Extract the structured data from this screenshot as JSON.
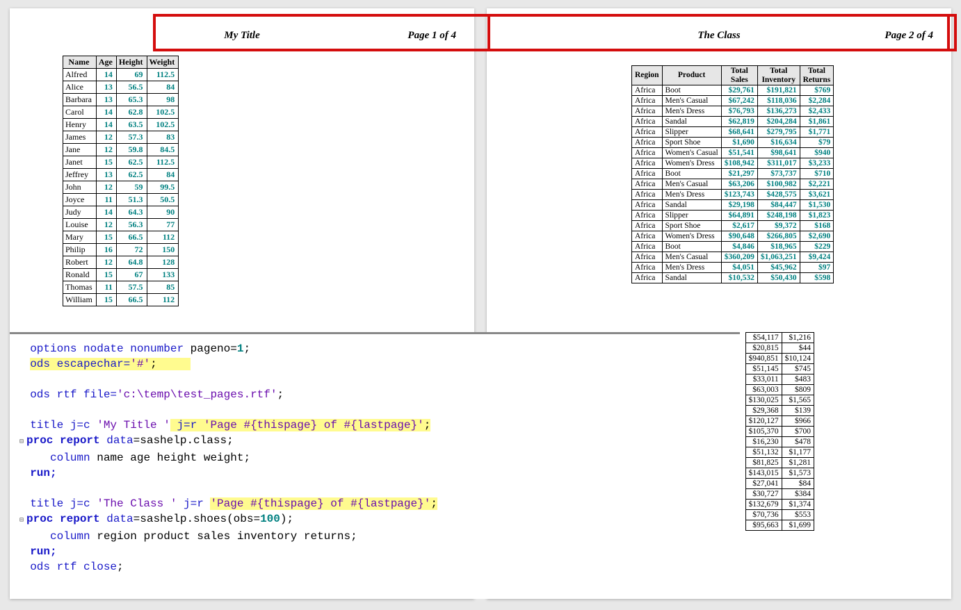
{
  "page1": {
    "title": "My Title",
    "page_label": "Page 1 of 4"
  },
  "page2": {
    "title": "The Class",
    "page_label": "Page 2 of 4"
  },
  "class_table": {
    "headers": [
      "Name",
      "Age",
      "Height",
      "Weight"
    ],
    "rows": [
      [
        "Alfred",
        "14",
        "69",
        "112.5"
      ],
      [
        "Alice",
        "13",
        "56.5",
        "84"
      ],
      [
        "Barbara",
        "13",
        "65.3",
        "98"
      ],
      [
        "Carol",
        "14",
        "62.8",
        "102.5"
      ],
      [
        "Henry",
        "14",
        "63.5",
        "102.5"
      ],
      [
        "James",
        "12",
        "57.3",
        "83"
      ],
      [
        "Jane",
        "12",
        "59.8",
        "84.5"
      ],
      [
        "Janet",
        "15",
        "62.5",
        "112.5"
      ],
      [
        "Jeffrey",
        "13",
        "62.5",
        "84"
      ],
      [
        "John",
        "12",
        "59",
        "99.5"
      ],
      [
        "Joyce",
        "11",
        "51.3",
        "50.5"
      ],
      [
        "Judy",
        "14",
        "64.3",
        "90"
      ],
      [
        "Louise",
        "12",
        "56.3",
        "77"
      ],
      [
        "Mary",
        "15",
        "66.5",
        "112"
      ],
      [
        "Philip",
        "16",
        "72",
        "150"
      ],
      [
        "Robert",
        "12",
        "64.8",
        "128"
      ],
      [
        "Ronald",
        "15",
        "67",
        "133"
      ],
      [
        "Thomas",
        "11",
        "57.5",
        "85"
      ],
      [
        "William",
        "15",
        "66.5",
        "112"
      ]
    ]
  },
  "shoes_table": {
    "headers": [
      "Region",
      "Product",
      "Total Sales",
      "Total Inventory",
      "Total Returns"
    ],
    "rows": [
      [
        "Africa",
        "Boot",
        "$29,761",
        "$191,821",
        "$769"
      ],
      [
        "Africa",
        "Men's Casual",
        "$67,242",
        "$118,036",
        "$2,284"
      ],
      [
        "Africa",
        "Men's Dress",
        "$76,793",
        "$136,273",
        "$2,433"
      ],
      [
        "Africa",
        "Sandal",
        "$62,819",
        "$204,284",
        "$1,861"
      ],
      [
        "Africa",
        "Slipper",
        "$68,641",
        "$279,795",
        "$1,771"
      ],
      [
        "Africa",
        "Sport Shoe",
        "$1,690",
        "$16,634",
        "$79"
      ],
      [
        "Africa",
        "Women's Casual",
        "$51,541",
        "$98,641",
        "$940"
      ],
      [
        "Africa",
        "Women's Dress",
        "$108,942",
        "$311,017",
        "$3,233"
      ],
      [
        "Africa",
        "Boot",
        "$21,297",
        "$73,737",
        "$710"
      ],
      [
        "Africa",
        "Men's Casual",
        "$63,206",
        "$100,982",
        "$2,221"
      ],
      [
        "Africa",
        "Men's Dress",
        "$123,743",
        "$428,575",
        "$3,621"
      ],
      [
        "Africa",
        "Sandal",
        "$29,198",
        "$84,447",
        "$1,530"
      ],
      [
        "Africa",
        "Slipper",
        "$64,891",
        "$248,198",
        "$1,823"
      ],
      [
        "Africa",
        "Sport Shoe",
        "$2,617",
        "$9,372",
        "$168"
      ],
      [
        "Africa",
        "Women's Dress",
        "$90,648",
        "$266,805",
        "$2,690"
      ],
      [
        "Africa",
        "Boot",
        "$4,846",
        "$18,965",
        "$229"
      ],
      [
        "Africa",
        "Men's Casual",
        "$360,209",
        "$1,063,251",
        "$9,424"
      ],
      [
        "Africa",
        "Men's Dress",
        "$4,051",
        "$45,962",
        "$97"
      ],
      [
        "Africa",
        "Sandal",
        "$10,532",
        "$50,430",
        "$598"
      ]
    ]
  },
  "overhang": {
    "rows": [
      [
        "$54,117",
        "$1,216"
      ],
      [
        "$20,815",
        "$44"
      ],
      [
        "$940,851",
        "$10,124"
      ],
      [
        "$51,145",
        "$745"
      ],
      [
        "$33,011",
        "$483"
      ],
      [
        "$63,003",
        "$809"
      ],
      [
        "$130,025",
        "$1,565"
      ],
      [
        "$29,368",
        "$139"
      ],
      [
        "$120,127",
        "$966"
      ],
      [
        "$105,370",
        "$700"
      ],
      [
        "$16,230",
        "$478"
      ],
      [
        "$51,132",
        "$1,177"
      ],
      [
        "$81,825",
        "$1,281"
      ],
      [
        "$143,015",
        "$1,573"
      ],
      [
        "$27,041",
        "$84"
      ],
      [
        "$30,727",
        "$384"
      ],
      [
        "$132,679",
        "$1,374"
      ],
      [
        "$70,736",
        "$553"
      ],
      [
        "$95,663",
        "$1,699"
      ]
    ]
  },
  "code": {
    "l1a": "options nodate nonumber",
    "l1b": " pageno=",
    "l1c": "1",
    "l1d": ";",
    "l2": "ods escapechar='#';",
    "l3a": "ods rtf ",
    "l3b": "file=",
    "l3c": "'c:\\temp\\test_pages.rtf'",
    "l3d": ";",
    "l4a": "title ",
    "l4b": "j=c ",
    "l4c": "'My Title '",
    "l4d": " j=r 'Page #{thispage} of #{lastpage}';",
    "l5a": "proc",
    "l5b": " report",
    "l5c": " data",
    "l5d": "=sashelp.class;",
    "l6a": "   column",
    "l6b": " name age height weight;",
    "l7": "run;",
    "l8a": "title ",
    "l8b": "j=c ",
    "l8c": "'The Class '",
    "l8d": " j=r ",
    "l8e": "'Page #{thispage} of #{lastpage}'",
    "l8f": ";",
    "l9a": "proc",
    "l9b": " report",
    "l9c": " data",
    "l9d": "=sashelp.shoes(obs=",
    "l9e": "100",
    "l9f": ");",
    "l10a": "   column",
    "l10b": " region product sales inventory returns;",
    "l11": "run;",
    "l12a": "ods rtf ",
    "l12b": "close",
    "l12c": ";"
  }
}
